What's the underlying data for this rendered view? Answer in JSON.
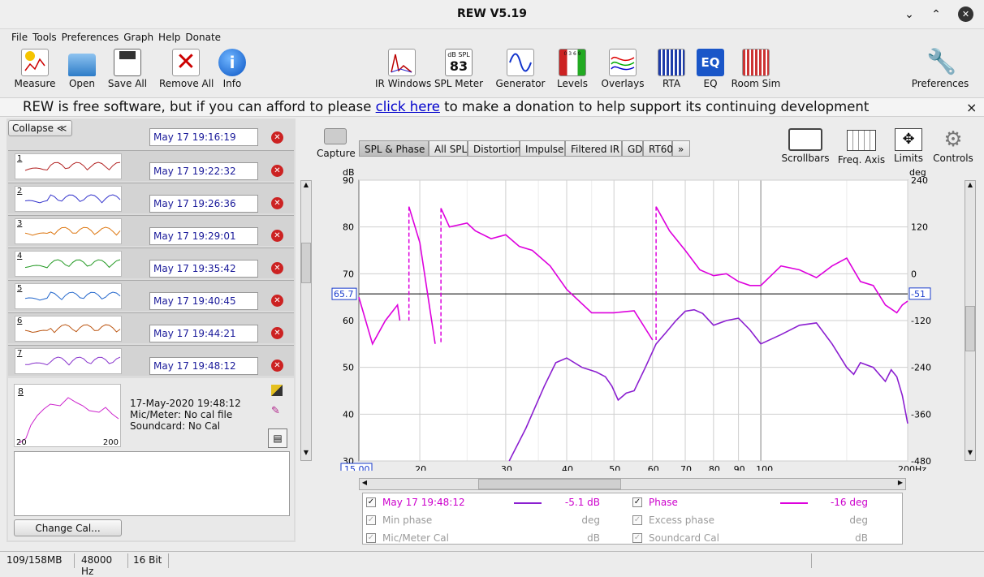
{
  "window": {
    "title": "REW V5.19",
    "minimize": "⌄",
    "maximize": "⌃",
    "close": "✕"
  },
  "menu": [
    "File",
    "Tools",
    "Preferences",
    "Graph",
    "Help",
    "Donate"
  ],
  "toolbar": {
    "left": [
      "Measure",
      "Open",
      "Save All",
      "Remove All",
      "Info"
    ],
    "center": [
      "IR Windows",
      "SPL Meter",
      "Generator",
      "Levels",
      "Overlays",
      "RTA",
      "EQ",
      "Room Sim"
    ],
    "right": [
      "Preferences"
    ],
    "spl_meter_icon_top": "dB SPL",
    "spl_meter_icon_value": "83",
    "eq_icon_text": "EQ",
    "levels_icon_text": "0 3 6 9"
  },
  "banner": {
    "before": "REW is free software, but if you can afford to please ",
    "link": "click here",
    "after": " to make a donation to help support its continuing development",
    "close": "×"
  },
  "panel": {
    "collapse_label": "Collapse ≪",
    "delete_icon": "✕"
  },
  "measurements": [
    {
      "num": "1",
      "date": "May 17 19:22:32",
      "color": "#b22222"
    },
    {
      "num": "2",
      "date": "May 17 19:26:36",
      "color": "#3333cc"
    },
    {
      "num": "3",
      "date": "May 17 19:29:01",
      "color": "#dd7711"
    },
    {
      "num": "4",
      "date": "May 17 19:35:42",
      "color": "#229922"
    },
    {
      "num": "5",
      "date": "May 17 19:40:45",
      "color": "#2266cc"
    },
    {
      "num": "6",
      "date": "May 17 19:44:21",
      "color": "#bb5511"
    },
    {
      "num": "7",
      "date": "May 17 19:48:12",
      "color": "#8833cc"
    }
  ],
  "top_measurement_date": "May 17 19:16:19",
  "selected": {
    "num": "8",
    "info_date": "17-May-2020 19:48:12",
    "mic": "Mic/Meter: No cal file",
    "soundcard": "Soundcard: No Cal",
    "x_start": "20",
    "x_end": "200",
    "change_cal": "Change Cal..."
  },
  "graph": {
    "capture": "Capture",
    "tabs": [
      "SPL & Phase",
      "All SPL",
      "Distortion",
      "Impulse",
      "Filtered IR",
      "GD",
      "RT60",
      "»"
    ],
    "right_tools": [
      "Scrollbars",
      "Freq. Axis",
      "Limits",
      "Controls"
    ],
    "left_axis_unit": "dB",
    "right_axis_unit": "deg",
    "y_ticks": [
      "90",
      "80",
      "70",
      "60",
      "50",
      "40",
      "30"
    ],
    "phase_ticks": [
      "240",
      "120",
      "0",
      "-120",
      "-240",
      "-360",
      "-480"
    ],
    "x_ticks": [
      "20",
      "30",
      "40",
      "50",
      "60",
      "70",
      "80",
      "90",
      "100",
      "200Hz"
    ],
    "x_start": "15.00",
    "cursor_left": "65.7",
    "cursor_right": "-51"
  },
  "chart_data": {
    "type": "line",
    "xlabel": "Hz",
    "ylabel": "dB",
    "x_scale": "log",
    "xlim": [
      15,
      200
    ],
    "ylim": [
      30,
      90
    ],
    "y2lim": [
      -480,
      240
    ],
    "y2label": "deg",
    "series": [
      {
        "name": "May 17 19:48:12",
        "color": "#8b1fd0",
        "axis": "left",
        "x": [
          30.5,
          33,
          36,
          38,
          40,
          43,
          46,
          48,
          49.5,
          51,
          53,
          55,
          58,
          61,
          64,
          67,
          70,
          73,
          76,
          80,
          85,
          90,
          95,
          100,
          110,
          120,
          130,
          140,
          150,
          155,
          160,
          170,
          180,
          185,
          190,
          195,
          200
        ],
        "y": [
          30,
          37,
          46,
          51,
          52,
          50,
          49,
          48,
          46,
          43,
          44.5,
          45,
          50,
          55,
          57.5,
          60,
          62,
          62.3,
          61.5,
          59,
          60,
          60.5,
          58,
          55,
          57,
          59,
          59.5,
          55,
          50,
          48.5,
          51,
          50,
          47,
          49.5,
          48,
          44,
          38
        ]
      },
      {
        "name": "Phase",
        "color": "#dd00dd",
        "axis": "right",
        "x": [
          15,
          16,
          17,
          18,
          18.2,
          19,
          20,
          21.5,
          22.1,
          23,
          25,
          26,
          28,
          30,
          32,
          34,
          37,
          40,
          45,
          50,
          55,
          60,
          61,
          65,
          70,
          75,
          80,
          85,
          90,
          95,
          100,
          110,
          120,
          130,
          140,
          150,
          160,
          170,
          180,
          190,
          195,
          200
        ],
        "y": [
          -60,
          -180,
          -120,
          -80,
          -120,
          172,
          80,
          -180,
          168,
          120,
          130,
          110,
          90,
          100,
          70,
          60,
          20,
          -40,
          -100,
          -100,
          -95,
          -170,
          172,
          110,
          60,
          10,
          -5,
          0,
          -20,
          -30,
          -30,
          20,
          10,
          -10,
          20,
          40,
          -20,
          -30,
          -80,
          -100,
          -80,
          -70
        ]
      }
    ],
    "legend": {
      "rows": [
        {
          "left": {
            "label": "May 17 19:48:12",
            "value": "-5.1 dB",
            "checked": true,
            "active": true
          },
          "right": {
            "label": "Phase",
            "value": "-16 deg",
            "checked": true,
            "active": true
          }
        },
        {
          "left": {
            "label": "Min phase",
            "value": "deg",
            "checked": true,
            "active": false
          },
          "right": {
            "label": "Excess phase",
            "value": "deg",
            "checked": true,
            "active": false
          }
        },
        {
          "left": {
            "label": "Mic/Meter Cal",
            "value": "dB",
            "checked": true,
            "active": false
          },
          "right": {
            "label": "Soundcard Cal",
            "value": "dB",
            "checked": true,
            "active": false
          }
        }
      ]
    }
  },
  "status": {
    "memory": "109/158MB",
    "rate": "48000 Hz",
    "bits": "16 Bit"
  },
  "colors": {
    "accent_magenta": "#dd00dd",
    "spl_purple": "#8b1fd0",
    "delete_red": "#cc2222",
    "link_blue": "#0000cc"
  }
}
